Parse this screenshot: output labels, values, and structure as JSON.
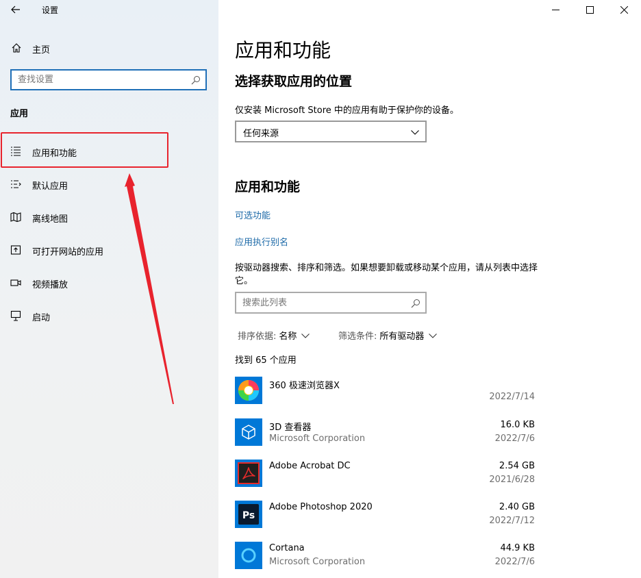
{
  "window": {
    "title": "设置"
  },
  "sidebar": {
    "home_label": "主页",
    "search_placeholder": "查找设置",
    "section": "应用",
    "items": [
      {
        "label": "应用和功能",
        "icon": "apps-list-icon"
      },
      {
        "label": "默认应用",
        "icon": "default-apps-icon"
      },
      {
        "label": "离线地图",
        "icon": "map-icon"
      },
      {
        "label": "可打开网站的应用",
        "icon": "web-app-icon"
      },
      {
        "label": "视频播放",
        "icon": "video-icon"
      },
      {
        "label": "启动",
        "icon": "startup-icon"
      }
    ]
  },
  "main": {
    "title": "应用和功能",
    "choose_title": "选择获取应用的位置",
    "choose_desc": "仅安装 Microsoft Store 中的应用有助于保护你的设备。",
    "source_value": "任何来源",
    "apps_title": "应用和功能",
    "link_optional": "可选功能",
    "link_alias": "应用执行别名",
    "list_desc": "按驱动器搜索、排序和筛选。如果想要卸载或移动某个应用，请从列表中选择它。",
    "list_search_placeholder": "搜索此列表",
    "sort_key": "排序依据:",
    "sort_value": "名称",
    "filter_key": "筛选条件:",
    "filter_value": "所有驱动器",
    "count_text": "找到 65 个应用",
    "apps": [
      {
        "name": "360 极速浏览器X",
        "publisher": "",
        "size": "",
        "date": "2022/7/14"
      },
      {
        "name": "3D 查看器",
        "publisher": "Microsoft Corporation",
        "size": "16.0 KB",
        "date": "2022/7/6"
      },
      {
        "name": "Adobe Acrobat DC",
        "publisher": "",
        "size": "2.54 GB",
        "date": "2021/6/28"
      },
      {
        "name": "Adobe Photoshop 2020",
        "publisher": "",
        "size": "2.40 GB",
        "date": "2022/7/12"
      },
      {
        "name": "Cortana",
        "publisher": "Microsoft Corporation",
        "size": "44.9 KB",
        "date": "2022/7/6"
      }
    ],
    "ps_icon_text": "Ps"
  },
  "colors": {
    "accent": "#1f6fb7",
    "link": "#1d6aa8",
    "highlight": "#e8232d",
    "app_tile": "#0078d7"
  }
}
